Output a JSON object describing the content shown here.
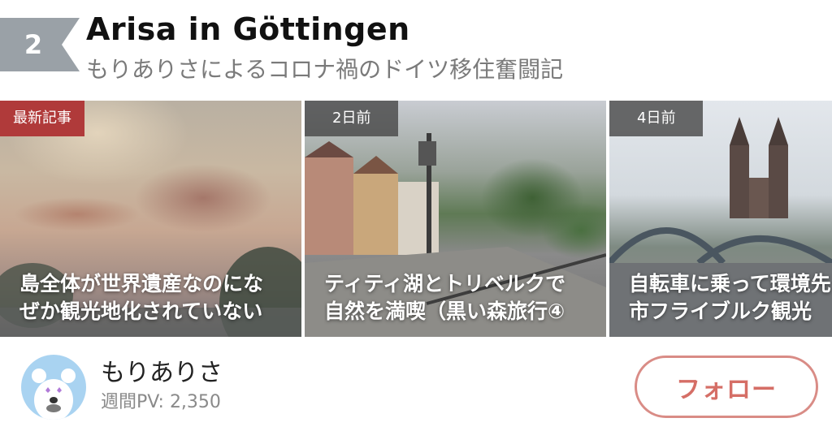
{
  "header": {
    "rank": "2",
    "title": "Arisa in Göttingen",
    "subtitle": "もりありさによるコロナ禍のドイツ移住奮闘記"
  },
  "articles": [
    {
      "badge": "最新記事",
      "title_line1": "島全体が世界遺産なのにな",
      "title_line2": "ぜか観光地化されていない"
    },
    {
      "badge": "2日前",
      "title_line1": "ティティ湖とトリベルクで",
      "title_line2": "自然を満喫（黒い森旅行④"
    },
    {
      "badge": "4日前",
      "title_line1": "自転車に乗って環境先",
      "title_line2": "市フライブルク観光"
    }
  ],
  "author": {
    "name": "もりありさ",
    "pv_label": "週間PV:",
    "pv_value": "2,350",
    "avatar_icon": "bear-avatar-icon"
  },
  "follow_button": {
    "label": "フォロー"
  },
  "colors": {
    "badge_new": "#b03a3a",
    "rank_badge": "#9aa1a7",
    "follow_accent": "#d56e66",
    "avatar_bg": "#a9d3f1"
  }
}
